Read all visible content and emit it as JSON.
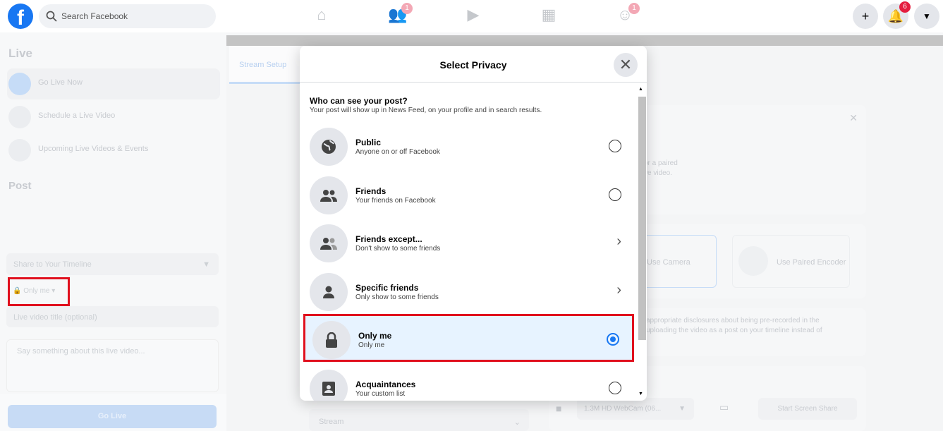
{
  "topbar": {
    "search_placeholder": "Search Facebook",
    "badges": {
      "friends": "1",
      "groups": "1",
      "notifications": "6"
    }
  },
  "sidebar": {
    "live_heading": "Live",
    "items": [
      {
        "label": "Go Live Now"
      },
      {
        "label": "Schedule a Live Video"
      },
      {
        "label": "Upcoming Live Videos & Events"
      }
    ],
    "post_heading": "Post",
    "share_select": "Share to Your Timeline",
    "privacy_button": "Only me",
    "title_placeholder": "Live video title (optional)",
    "description_placeholder": "Say something about this live video...",
    "go_live": "Go Live"
  },
  "main": {
    "tab": "Stream Setup",
    "info_text_1": "or a paired",
    "info_text_2": "ve video.",
    "use_camera": "Use Camera",
    "use_paired_encoder": "Use Paired Encoder",
    "disclosure_1": "appropriate disclosures about being pre-recorded in the",
    "disclosure_2": "uploading the video as a post on your timeline instead of",
    "stream_select": "Stream",
    "webcam_select": "1.3M HD WebCam (06...",
    "screen_share": "Start Screen Share"
  },
  "modal": {
    "title": "Select Privacy",
    "question": "Who can see your post?",
    "question_sub": "Your post will show up in News Feed, on your profile and in search results.",
    "options": [
      {
        "title": "Public",
        "sub": "Anyone on or off Facebook",
        "icon": "globe-icon",
        "control": "radio",
        "selected": false
      },
      {
        "title": "Friends",
        "sub": "Your friends on Facebook",
        "icon": "friends-icon",
        "control": "radio",
        "selected": false
      },
      {
        "title": "Friends except...",
        "sub": "Don't show to some friends",
        "icon": "friends-except-icon",
        "control": "chevron",
        "selected": false
      },
      {
        "title": "Specific friends",
        "sub": "Only show to some friends",
        "icon": "person-icon",
        "control": "chevron",
        "selected": false
      },
      {
        "title": "Only me",
        "sub": "Only me",
        "icon": "lock-icon",
        "control": "radio",
        "selected": true
      },
      {
        "title": "Acquaintances",
        "sub": "Your custom list",
        "icon": "contact-list-icon",
        "control": "radio",
        "selected": false
      }
    ]
  },
  "colors": {
    "accent": "#1877f2",
    "highlight": "#e0101e",
    "selected_bg": "#e7f3ff"
  }
}
